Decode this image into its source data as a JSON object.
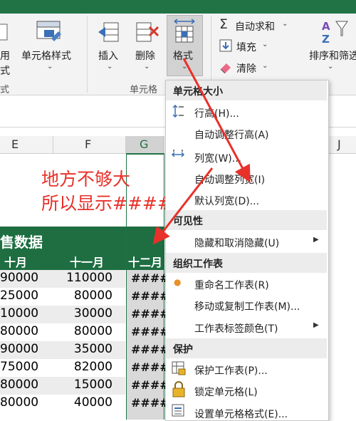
{
  "ribbon": {
    "cell_style_label": "单元格样式",
    "insert_label": "插入",
    "delete_label": "删除",
    "format_label": "格式",
    "cells_group_label": "单元格",
    "autosum_label": "自动求和",
    "fill_label": "填充",
    "clear_label": "清除",
    "sort_filter_label": "排序和筛选",
    "partial_left_label_1": "用",
    "partial_left_label_2": "式",
    "partial_left_group": "式"
  },
  "columns": [
    "E",
    "F",
    "G",
    "J"
  ],
  "annotation": {
    "line1": "地方不够大",
    "line2": "所以显示####"
  },
  "sheet": {
    "title_partial": "售数据",
    "headers": [
      "十月",
      "十一月",
      "十二月"
    ],
    "rows": [
      {
        "e": "90000",
        "f": "110000",
        "g": "####"
      },
      {
        "e": "25000",
        "f": "80000",
        "g": "####"
      },
      {
        "e": "10000",
        "f": "30000",
        "g": "####"
      },
      {
        "e": "80000",
        "f": "80000",
        "g": "####"
      },
      {
        "e": "90000",
        "f": "35000",
        "g": "####"
      },
      {
        "e": "75000",
        "f": "82000",
        "g": "####"
      },
      {
        "e": "80000",
        "f": "15000",
        "g": "####"
      },
      {
        "e": "80000",
        "f": "40000",
        "g": "####"
      }
    ]
  },
  "menu": {
    "cell_size_header": "单元格大小",
    "row_height": "行高(H)...",
    "autofit_row": "自动调整行高(A)",
    "col_width": "列宽(W)...",
    "autofit_col": "自动调整列宽(I)",
    "default_width": "默认列宽(D)...",
    "visibility_header": "可见性",
    "hide_unhide": "隐藏和取消隐藏(U)",
    "organize_header": "组织工作表",
    "rename_sheet": "重命名工作表(R)",
    "move_copy": "移动或复制工作表(M)...",
    "tab_color": "工作表标签颜色(T)",
    "protect_header": "保护",
    "protect_sheet": "保护工作表(P)...",
    "lock_cell": "锁定单元格(L)",
    "format_cells": "设置单元格格式(E)..."
  },
  "colors": {
    "excel_green": "#217346",
    "sheet_header_green": "#1e6e42",
    "arrow_red": "#e8312a",
    "annotation_red": "#e8312a"
  }
}
